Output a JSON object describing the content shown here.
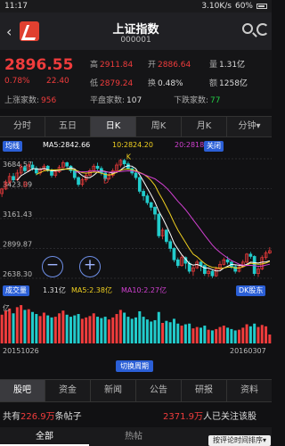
{
  "status": {
    "time": "11:17",
    "speed": "3.10K/s",
    "battery": "60%"
  },
  "header": {
    "title": "上证指数",
    "code": "000001"
  },
  "quote": {
    "price": "2896.55",
    "pct": "0.78%",
    "change": "22.40",
    "high_label": "高",
    "high": "2911.84",
    "open_label": "开",
    "open": "2886.64",
    "volume_label": "量",
    "volume": "1.31亿",
    "low_label": "低",
    "low": "2879.24",
    "turnover_label": "换",
    "turnover": "0.48%",
    "amount_label": "额",
    "amount": "1258亿",
    "up_label": "上涨家数:",
    "up": "956",
    "flat_label": "平盘家数:",
    "flat": "107",
    "down_label": "下跌家数:",
    "down": "77"
  },
  "tabs": [
    {
      "label": "分时",
      "active": false
    },
    {
      "label": "五日",
      "active": false
    },
    {
      "label": "日K",
      "active": true
    },
    {
      "label": "周K",
      "active": false
    },
    {
      "label": "月K",
      "active": false
    },
    {
      "label": "分钟▾",
      "active": false
    }
  ],
  "ma": {
    "indicator_btn": "均线",
    "ma5": "MA5:2842.66",
    "ma10": "10:2824.20",
    "ma20": "20:2818.77",
    "close_btn": "关闭"
  },
  "yticks": [
    "3684.57",
    "3423.09",
    "3161.43",
    "2899.87",
    "2638.30"
  ],
  "markers": {
    "k": "K",
    "b": "B",
    "d": "D"
  },
  "vol": {
    "indicator_btn": "成交量",
    "value": "1.31亿",
    "ma5": "MA5:2.38亿",
    "ma10": "MA10:2.27亿",
    "close_btn": "DK股东",
    "unit": "亿"
  },
  "dates": {
    "start": "20151026",
    "end": "20160307"
  },
  "switch_label": "切换周期",
  "info_tabs": [
    {
      "label": "股吧",
      "active": true
    },
    {
      "label": "资金",
      "active": false
    },
    {
      "label": "新闻",
      "active": false
    },
    {
      "label": "公告",
      "active": false
    },
    {
      "label": "研报",
      "active": false
    },
    {
      "label": "资料",
      "active": false
    }
  ],
  "discuss": {
    "pre": "共有",
    "count": "226.9万",
    "post": "条帖子",
    "followers": "2371.9万",
    "followers_post": "人已关注该股"
  },
  "sub_tabs": [
    {
      "label": "全部",
      "active": true
    },
    {
      "label": "热帖",
      "active": false
    }
  ],
  "sort_label": "按评论时间排序▾",
  "colors": {
    "up": "#f03c3c",
    "down": "#22cccc",
    "ma5": "#ffffff",
    "ma10": "#f0d020",
    "ma20": "#d040d0",
    "accent": "#2b5fd6"
  },
  "chart_data": {
    "type": "candlestick",
    "ylim": [
      2638.3,
      3684.57
    ],
    "yticks": [
      3684.57,
      3423.09,
      3161.43,
      2899.87,
      2638.3
    ],
    "candles": [
      [
        3380,
        3420,
        3350,
        3430
      ],
      [
        3420,
        3480,
        3410,
        3500
      ],
      [
        3480,
        3530,
        3460,
        3560
      ],
      [
        3530,
        3500,
        3480,
        3560
      ],
      [
        3500,
        3560,
        3490,
        3590
      ],
      [
        3560,
        3610,
        3540,
        3640
      ],
      [
        3610,
        3580,
        3560,
        3630
      ],
      [
        3580,
        3630,
        3570,
        3650
      ],
      [
        3630,
        3600,
        3580,
        3660
      ],
      [
        3600,
        3560,
        3540,
        3620
      ],
      [
        3560,
        3590,
        3540,
        3610
      ],
      [
        3590,
        3620,
        3580,
        3640
      ],
      [
        3620,
        3580,
        3570,
        3630
      ],
      [
        3580,
        3540,
        3520,
        3600
      ],
      [
        3540,
        3570,
        3520,
        3590
      ],
      [
        3570,
        3610,
        3560,
        3630
      ],
      [
        3610,
        3650,
        3600,
        3670
      ],
      [
        3650,
        3620,
        3600,
        3660
      ],
      [
        3620,
        3580,
        3560,
        3630
      ],
      [
        3580,
        3520,
        3500,
        3590
      ],
      [
        3520,
        3460,
        3440,
        3530
      ],
      [
        3460,
        3500,
        3440,
        3520
      ],
      [
        3500,
        3540,
        3480,
        3560
      ],
      [
        3540,
        3580,
        3530,
        3600
      ],
      [
        3580,
        3620,
        3570,
        3640
      ],
      [
        3620,
        3600,
        3580,
        3650
      ],
      [
        3600,
        3560,
        3540,
        3620
      ],
      [
        3560,
        3510,
        3490,
        3570
      ],
      [
        3510,
        3540,
        3500,
        3560
      ],
      [
        3540,
        3580,
        3520,
        3600
      ],
      [
        3580,
        3630,
        3570,
        3650
      ],
      [
        3630,
        3670,
        3610,
        3684
      ],
      [
        3670,
        3640,
        3620,
        3684
      ],
      [
        3640,
        3600,
        3590,
        3660
      ],
      [
        3600,
        3560,
        3540,
        3610
      ],
      [
        3560,
        3520,
        3500,
        3580
      ],
      [
        3520,
        3400,
        3380,
        3530
      ],
      [
        3400,
        3360,
        3320,
        3420
      ],
      [
        3360,
        3300,
        3280,
        3380
      ],
      [
        3300,
        3260,
        3230,
        3310
      ],
      [
        3260,
        3200,
        3150,
        3270
      ],
      [
        3200,
        3010,
        2990,
        3210
      ],
      [
        3010,
        3060,
        2980,
        3080
      ],
      [
        3060,
        2960,
        2940,
        3070
      ],
      [
        2960,
        2900,
        2870,
        2980
      ],
      [
        2900,
        2800,
        2780,
        2910
      ],
      [
        2800,
        2750,
        2730,
        2820
      ],
      [
        2750,
        2820,
        2740,
        2840
      ],
      [
        2820,
        2770,
        2720,
        2830
      ],
      [
        2770,
        2700,
        2680,
        2790
      ],
      [
        2700,
        2730,
        2660,
        2750
      ],
      [
        2730,
        2780,
        2720,
        2800
      ],
      [
        2780,
        2750,
        2700,
        2790
      ],
      [
        2750,
        2680,
        2660,
        2760
      ],
      [
        2680,
        2700,
        2650,
        2720
      ],
      [
        2700,
        2660,
        2640,
        2710
      ],
      [
        2660,
        2720,
        2650,
        2740
      ],
      [
        2720,
        2760,
        2710,
        2790
      ],
      [
        2760,
        2800,
        2750,
        2820
      ],
      [
        2800,
        2780,
        2760,
        2830
      ],
      [
        2780,
        2740,
        2720,
        2790
      ],
      [
        2740,
        2700,
        2680,
        2760
      ],
      [
        2700,
        2740,
        2690,
        2760
      ],
      [
        2740,
        2780,
        2730,
        2800
      ],
      [
        2780,
        2850,
        2770,
        2860
      ],
      [
        2850,
        2830,
        2810,
        2870
      ],
      [
        2830,
        2680,
        2660,
        2840
      ],
      [
        2680,
        2720,
        2650,
        2740
      ],
      [
        2720,
        2820,
        2710,
        2840
      ],
      [
        2820,
        2860,
        2800,
        2880
      ],
      [
        2860,
        2880,
        2850,
        2911
      ]
    ],
    "volume_ylim": [
      0,
      6
    ],
    "volumes": [
      4.2,
      4.8,
      5.1,
      4.4,
      5.3,
      5.6,
      4.9,
      5.0,
      4.6,
      4.3,
      4.0,
      4.5,
      4.1,
      3.8,
      3.9,
      4.4,
      4.8,
      4.2,
      3.9,
      4.1,
      4.3,
      3.6,
      3.8,
      4.0,
      4.4,
      3.9,
      3.7,
      3.9,
      3.5,
      3.8,
      4.3,
      4.9,
      4.5,
      3.9,
      3.6,
      3.8,
      4.7,
      3.9,
      3.5,
      3.2,
      3.4,
      4.6,
      3.0,
      3.3,
      3.1,
      3.6,
      2.9,
      2.6,
      2.8,
      2.9,
      2.2,
      2.4,
      2.3,
      2.6,
      2.0,
      1.9,
      2.1,
      2.4,
      2.6,
      2.3,
      2.1,
      1.9,
      2.0,
      2.3,
      2.8,
      2.5,
      2.9,
      2.4,
      2.7,
      2.5,
      1.3
    ]
  }
}
